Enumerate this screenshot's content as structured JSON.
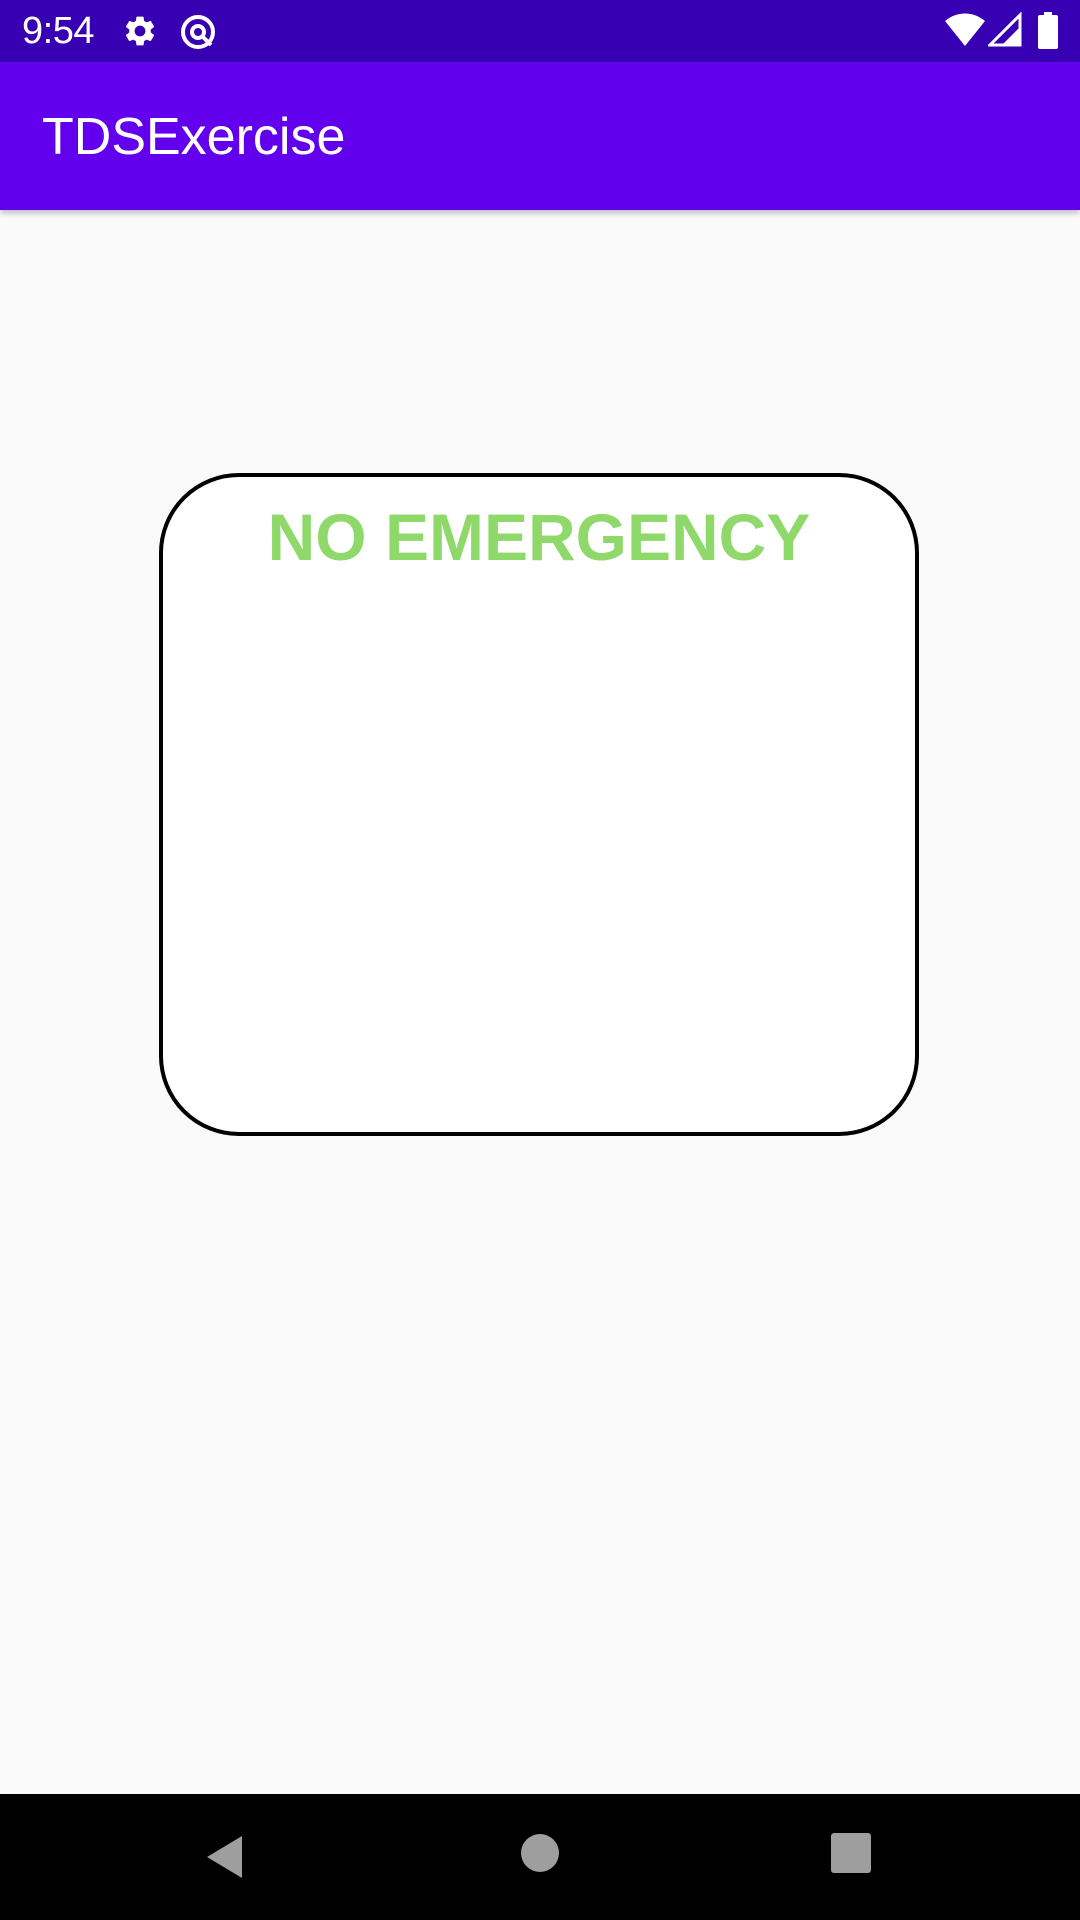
{
  "status_bar": {
    "time": "9:54",
    "icons": [
      "gear-icon",
      "location-sync-icon",
      "wifi-icon",
      "cell-signal-icon",
      "battery-icon"
    ]
  },
  "app_bar": {
    "title": "TDSExercise"
  },
  "card": {
    "status_text": "NO EMERGENCY",
    "status_color": "#8fd96b"
  },
  "nav_bar": {
    "buttons": [
      "back-icon",
      "home-icon",
      "recents-icon"
    ]
  },
  "colors": {
    "status_bar": "#3700b3",
    "app_bar": "#6200ee",
    "background": "#fafafa",
    "nav_bar": "#000000"
  }
}
